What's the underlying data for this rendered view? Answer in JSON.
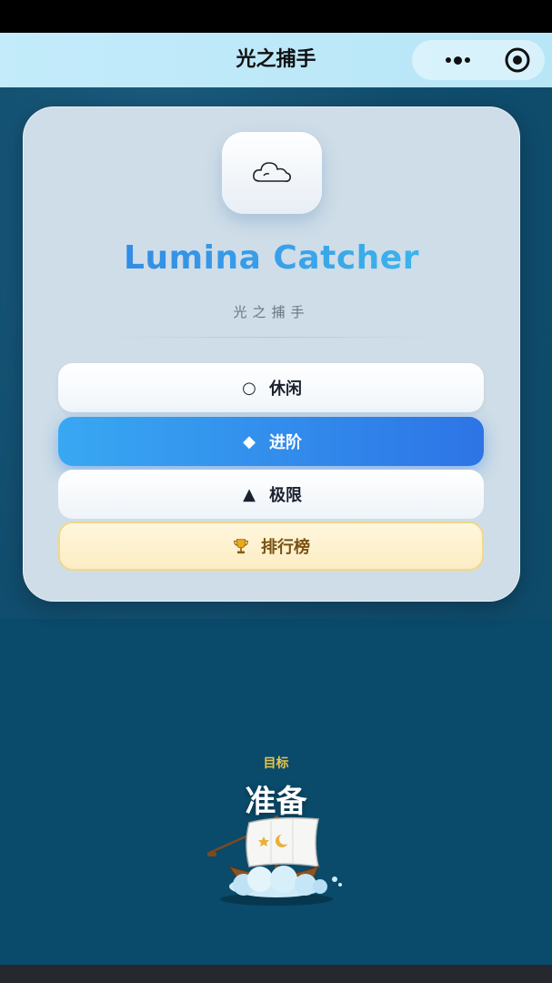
{
  "navbar": {
    "title": "光之捕手"
  },
  "menu": {
    "app_title": "Lumina Catcher",
    "app_subtitle": "光之捕手",
    "buttons": {
      "casual": {
        "icon": "○",
        "label": "休闲"
      },
      "advanced": {
        "icon": "◆",
        "label": "进阶"
      },
      "extreme": {
        "icon": "▲",
        "label": "极限"
      },
      "leaderboard": {
        "icon": "trophy-icon",
        "label": "排行榜"
      }
    }
  },
  "game": {
    "target_label": "目标",
    "target_value": "准备"
  },
  "colors": {
    "accent_blue": "#2d74e6",
    "gold": "#e8c44d",
    "background": "#0e4a6a"
  }
}
